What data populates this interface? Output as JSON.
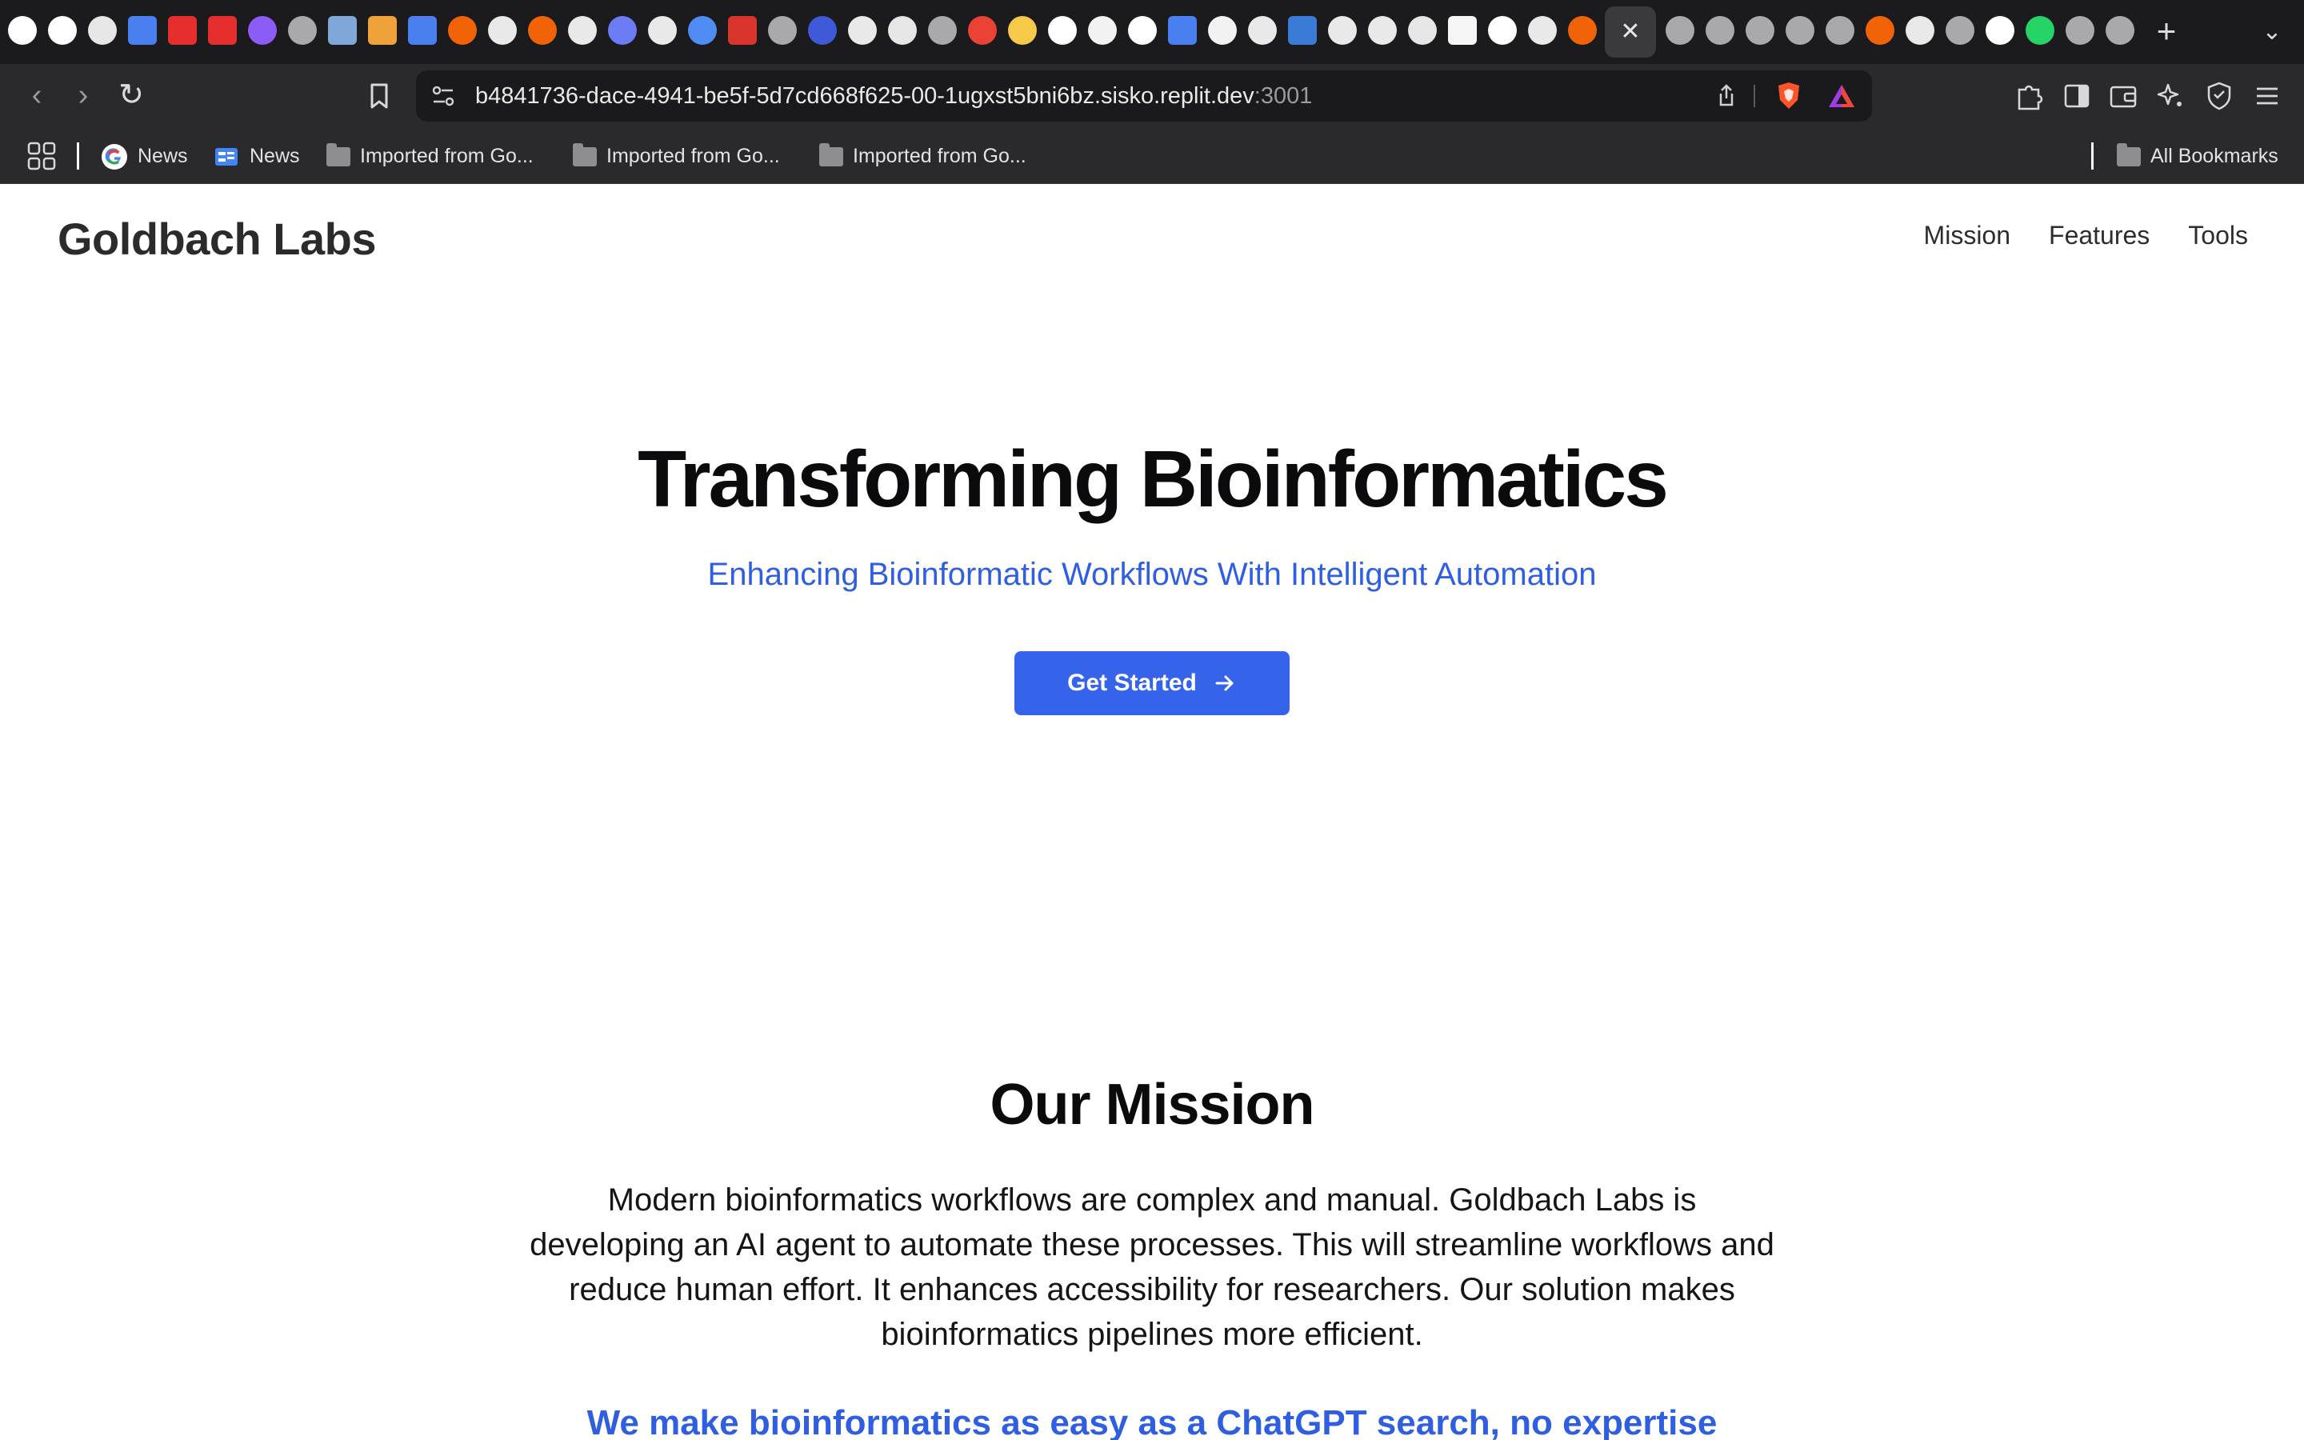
{
  "browser": {
    "address_url": "b4841736-dace-4941-be5f-5d7cd668f625-00-1ugxst5bni6bz.sisko.replit.dev",
    "address_port": ":3001",
    "active_tab_close": "✕",
    "new_tab": "+",
    "tab_list": "⌄",
    "back": "‹",
    "forward": "›",
    "reload": "↻",
    "tab_icons": [
      "github-icon",
      "github-icon",
      "perplexity-icon",
      "google-docs-icon",
      "youtube-icon",
      "youtube-icon",
      "u-badge-icon",
      "globe-icon",
      "pdf-thumb-icon",
      "folder-app-icon",
      "google-docs-icon",
      "replit-icon",
      "openai-icon",
      "replit-icon",
      "openai-icon",
      "cohere-icon",
      "openai-icon",
      "sparkle-icon",
      "scribd-icon",
      "globe-icon",
      "arc-icon",
      "openai-icon",
      "perplexity-icon",
      "globe-icon",
      "gmail-icon",
      "huggingface-icon",
      "github-icon",
      "ollama-icon",
      "github-icon",
      "google-docs-icon",
      "x-icon",
      "openai-icon",
      "bar-chart-icon",
      "openai-icon",
      "openai-icon",
      "perplexity-icon",
      "wikipedia-icon",
      "github-icon",
      "openai-icon",
      "replit-icon"
    ],
    "tab_icons_after_active": [
      "globe-icon",
      "globe-icon",
      "globe-icon",
      "globe-icon",
      "globe-icon",
      "replit-icon",
      "openai-icon",
      "globe-icon",
      "tether-icon",
      "whatsapp-icon",
      "globe-icon",
      "globe-icon"
    ],
    "colors": {
      "chrome_bg": "#1f1f22",
      "tab_strip_bg": "#1b1b1e",
      "toolbar_bg": "#2a2a2d",
      "brave_orange": "#fb542b"
    }
  },
  "bookmarks": {
    "items": [
      {
        "label": "News",
        "icon": "google-icon"
      },
      {
        "label": "News",
        "icon": "google-news-icon"
      },
      {
        "label": "Imported from Go...",
        "icon": "folder-icon"
      },
      {
        "label": "Imported from Go...",
        "icon": "folder-icon"
      },
      {
        "label": "Imported from Go...",
        "icon": "folder-icon"
      }
    ],
    "all_bookmarks": "All Bookmarks"
  },
  "site": {
    "brand": "Goldbach Labs",
    "nav": [
      "Mission",
      "Features",
      "Tools"
    ],
    "hero": {
      "title": "Transforming Bioinformatics",
      "subtitle": "Enhancing Bioinformatic Workflows With Intelligent Automation",
      "cta_label": "Get Started",
      "cta_icon": "arrow-right-icon"
    },
    "mission": {
      "title": "Our Mission",
      "body": "Modern bioinformatics workflows are complex and manual. Goldbach Labs is developing an AI agent to automate these processes. This will streamline workflows and reduce human effort. It enhances accessibility for researchers. Our solution makes bioinformatics pipelines more efficient.",
      "tagline": "We make bioinformatics as easy as a ChatGPT search, no expertise"
    },
    "colors": {
      "accent": "#3563e9",
      "accent_text": "#2f5fe0",
      "heading": "#0b0b0d",
      "body_text": "#151518"
    }
  }
}
